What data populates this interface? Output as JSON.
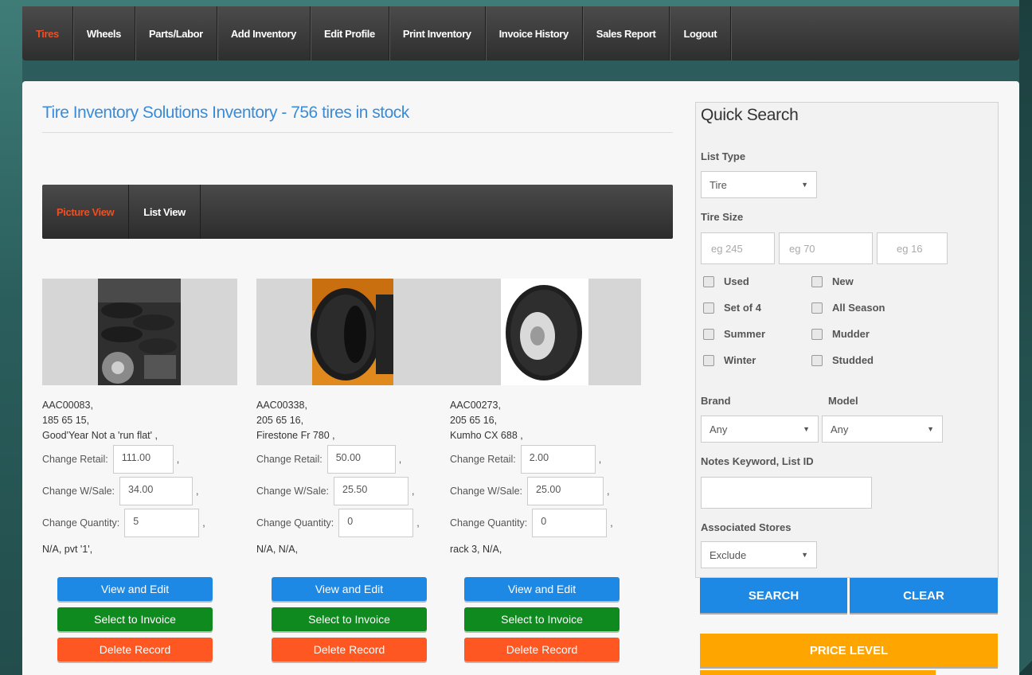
{
  "nav": {
    "items": [
      "Tires",
      "Wheels",
      "Parts/Labor",
      "Add Inventory",
      "Edit Profile",
      "Print Inventory",
      "Invoice History",
      "Sales Report",
      "Logout"
    ],
    "active_color": "#f04e23"
  },
  "page": {
    "title": "Tire Inventory Solutions Inventory - 756 tires in stock"
  },
  "view_tabs": [
    "Picture View",
    "List View"
  ],
  "field_labels": {
    "retail": "Change Retail:",
    "wsale": "Change W/Sale:",
    "quantity": "Change Quantity:"
  },
  "cards": [
    {
      "id": "AAC00083,",
      "size": "185 65 15,",
      "desc": "Good'Year Not a 'run flat' ,",
      "retail": "111.00",
      "wsale": "34.00",
      "quantity": "5",
      "note": "N/A,  pvt '1',"
    },
    {
      "id": "AAC00338,",
      "size": "205 65 16,",
      "desc": "Firestone Fr 780 ,",
      "retail": "50.00",
      "wsale": "25.50",
      "quantity": "0",
      "note": "N/A,  N/A,"
    },
    {
      "id": "AAC00273,",
      "size": "205 65 16,",
      "desc": "Kumho CX 688 ,",
      "retail": "2.00",
      "wsale": "25.00",
      "quantity": "0",
      "note": "rack 3,  N/A,"
    }
  ],
  "card_buttons": {
    "view": "View and Edit",
    "invoice": "Select to Invoice",
    "delete": "Delete Record"
  },
  "card_separator": ",",
  "quick_search": {
    "title": "Quick Search",
    "list_type_label": "List Type",
    "list_type_value": "Tire",
    "tire_size_label": "Tire Size",
    "size_placeholders": [
      "eg 245",
      "eg 70",
      "eg 16"
    ],
    "checkboxes": [
      "Used",
      "New",
      "Set of 4",
      "All Season",
      "Summer",
      "Mudder",
      "Winter",
      "Studded"
    ],
    "brand_label": "Brand",
    "brand_value": "Any",
    "model_label": "Model",
    "model_value": "Any",
    "notes_label": "Notes Keyword, List ID",
    "stores_label": "Associated Stores",
    "stores_value": "Exclude",
    "search_btn": "SEARCH",
    "clear_btn": "CLEAR",
    "price_level_btn": "PRICE LEVEL"
  },
  "colors": {
    "blue_button": "#1e88e5",
    "green_button": "#0f8a1f",
    "orange_button": "#ff5722",
    "price_level": "#ffa500",
    "title_blue": "#3a8cd8"
  }
}
